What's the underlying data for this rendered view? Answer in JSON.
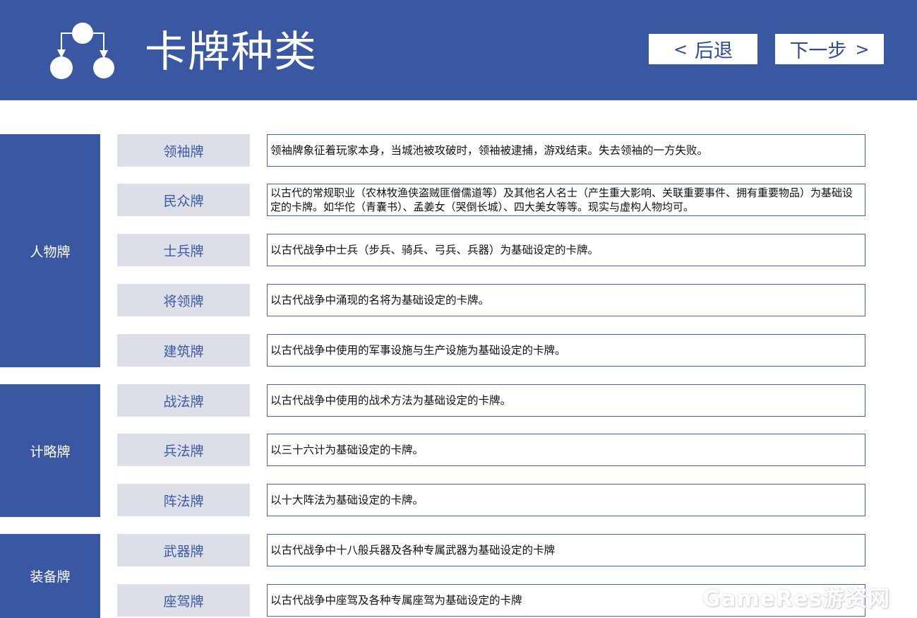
{
  "header": {
    "title": "卡牌种类",
    "back_label": "后退",
    "next_label": "下一步",
    "back_chevron": "<",
    "next_chevron": ">",
    "logo_icon": "hierarchy-diagram-icon",
    "background_color": "#3a57a1"
  },
  "categories": [
    {
      "label": "人物牌"
    },
    {
      "label": "计略牌"
    },
    {
      "label": "装备牌"
    }
  ],
  "cards": [
    {
      "name": "领袖牌",
      "desc": "领袖牌象征着玩家本身，当城池被攻破时，领袖被逮捕，游戏结束。失去领袖的一方失败。"
    },
    {
      "name": "民众牌",
      "desc": "以古代的常规职业（农林牧渔侠盗贼匪僧儒道等）及其他名人名士（产生重大影响、关联重要事件、拥有重要物品）为基础设定的卡牌。如华佗（青囊书）、孟姜女（哭倒长城）、四大美女等等。现实与虚构人物均可。"
    },
    {
      "name": "士兵牌",
      "desc": "以古代战争中士兵（步兵、骑兵、弓兵、兵器）为基础设定的卡牌。"
    },
    {
      "name": "将领牌",
      "desc": "以古代战争中涌现的名将为基础设定的卡牌。"
    },
    {
      "name": "建筑牌",
      "desc": "以古代战争中使用的军事设施与生产设施为基础设定的卡牌。"
    },
    {
      "name": "战法牌",
      "desc": "以古代战争中使用的战术方法为基础设定的卡牌。"
    },
    {
      "name": "兵法牌",
      "desc": "以三十六计为基础设定的卡牌。"
    },
    {
      "name": "阵法牌",
      "desc": "以十大阵法为基础设定的卡牌。"
    },
    {
      "name": "武器牌",
      "desc": "以古代战争中十八般兵器及各种专属武器为基础设定的卡牌"
    },
    {
      "name": "座驾牌",
      "desc": "以古代战争中座驾及各种专属座驾为基础设定的卡牌"
    }
  ],
  "watermark": "GameRes游资网"
}
